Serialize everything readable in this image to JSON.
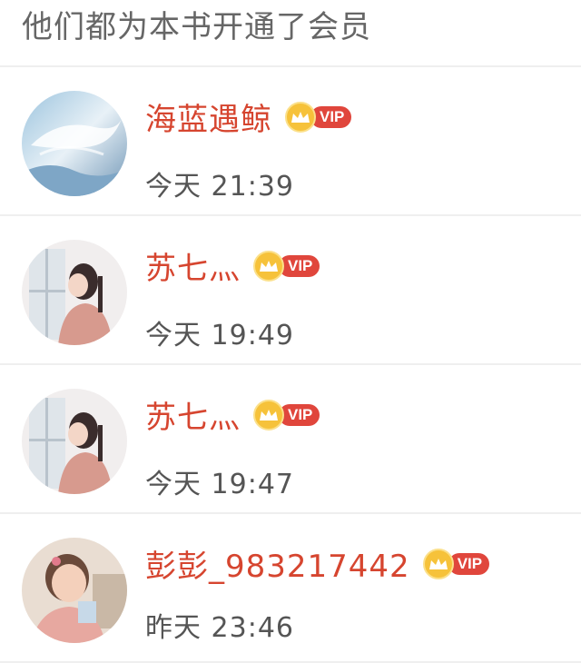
{
  "header": {
    "title": "他们都为本书开通了会员"
  },
  "members": [
    {
      "name": "海蓝遇鲸",
      "badge": "VIP",
      "time": "今天 21:39",
      "avatar_icon": "whale-sky-avatar"
    },
    {
      "name": "苏七灬",
      "badge": "VIP",
      "time": "今天 19:49",
      "avatar_icon": "girl-window-avatar"
    },
    {
      "name": "苏七灬",
      "badge": "VIP",
      "time": "今天 19:47",
      "avatar_icon": "girl-window-avatar"
    },
    {
      "name": "彭彭_983217442",
      "badge": "VIP",
      "time": "昨天 23:46",
      "avatar_icon": "child-avatar"
    }
  ],
  "colors": {
    "name": "#d6452f",
    "vip_tag": "#e0463c",
    "crown": "#f6c23a"
  }
}
